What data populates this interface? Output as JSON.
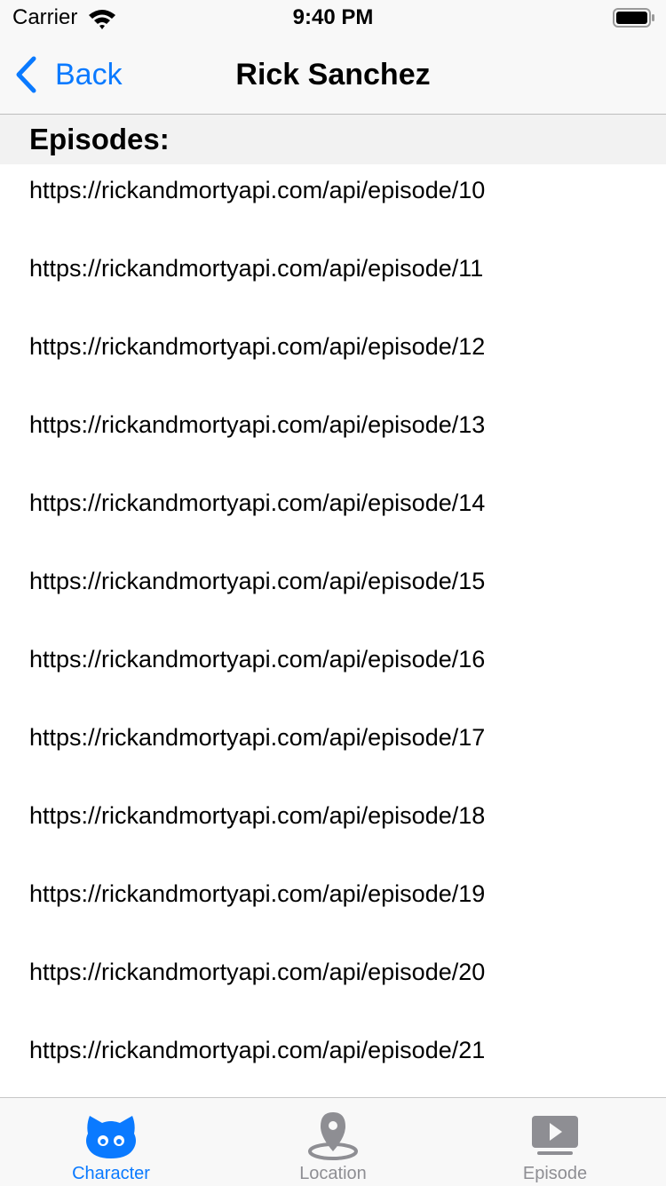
{
  "status_bar": {
    "carrier": "Carrier",
    "time": "9:40 PM"
  },
  "nav": {
    "back_label": "Back",
    "title": "Rick Sanchez",
    "accent_color": "#0a7aff"
  },
  "section": {
    "title": "Episodes:"
  },
  "episodes": [
    "https://rickandmortyapi.com/api/episode/10",
    "https://rickandmortyapi.com/api/episode/11",
    "https://rickandmortyapi.com/api/episode/12",
    "https://rickandmortyapi.com/api/episode/13",
    "https://rickandmortyapi.com/api/episode/14",
    "https://rickandmortyapi.com/api/episode/15",
    "https://rickandmortyapi.com/api/episode/16",
    "https://rickandmortyapi.com/api/episode/17",
    "https://rickandmortyapi.com/api/episode/18",
    "https://rickandmortyapi.com/api/episode/19",
    "https://rickandmortyapi.com/api/episode/20",
    "https://rickandmortyapi.com/api/episode/21"
  ],
  "tabs": [
    {
      "label": "Character",
      "icon": "character-icon",
      "selected": true
    },
    {
      "label": "Location",
      "icon": "location-pin-icon",
      "selected": false
    },
    {
      "label": "Episode",
      "icon": "play-screen-icon",
      "selected": false
    }
  ],
  "colors": {
    "tab_selected": "#0a7aff",
    "tab_unselected": "#8e8e93"
  }
}
